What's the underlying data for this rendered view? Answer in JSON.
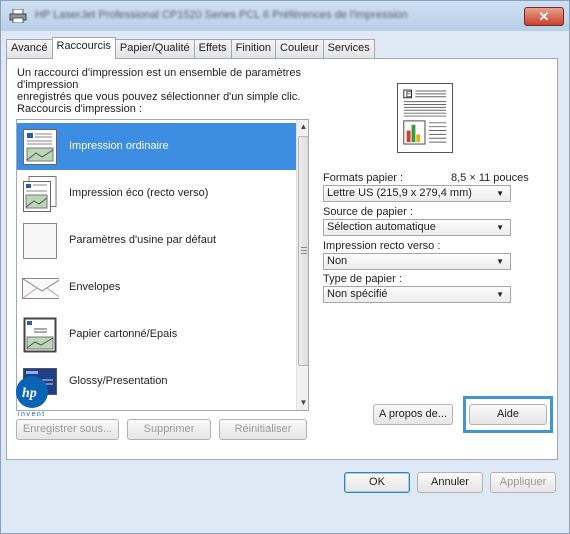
{
  "window": {
    "title": "HP LaserJet Professional CP1520 Series PCL 6 Préférences de l'impression",
    "close_label": "✕"
  },
  "tabs": [
    {
      "label": "Avancé",
      "active": false
    },
    {
      "label": "Raccourcis",
      "active": true
    },
    {
      "label": "Papier/Qualité",
      "active": false
    },
    {
      "label": "Effets",
      "active": false
    },
    {
      "label": "Finition",
      "active": false
    },
    {
      "label": "Couleur",
      "active": false
    },
    {
      "label": "Services",
      "active": false
    }
  ],
  "description_line1": "Un raccourci d'impression est un ensemble de paramètres d'impression",
  "description_line2": "enregistrés que vous pouvez sélectionner d'un simple clic.",
  "shortcuts_label": "Raccourcis d'impression :",
  "shortcuts": [
    {
      "label": "Impression ordinaire",
      "icon": "document-icon",
      "selected": true
    },
    {
      "label": "Impression éco (recto verso)",
      "icon": "duplex-document-icon",
      "selected": false
    },
    {
      "label": "Paramètres d'usine par défaut",
      "icon": "blank-page-icon",
      "selected": false
    },
    {
      "label": "Envelopes",
      "icon": "envelope-icon",
      "selected": false
    },
    {
      "label": "Papier cartonné/Epais",
      "icon": "cardstock-icon",
      "selected": false
    },
    {
      "label": "Glossy/Presentation",
      "icon": "presentation-icon",
      "selected": false
    }
  ],
  "list_buttons": {
    "save_as": "Enregistrer sous...",
    "delete": "Supprimer",
    "reset": "Réinitialiser"
  },
  "settings": {
    "paper_size_label": "Formats papier :",
    "paper_size_dim": "8,5 × 11 pouces",
    "paper_size_value": "Lettre US (215,9 x 279,4 mm)",
    "paper_source_label": "Source de papier :",
    "paper_source_value": "Sélection automatique",
    "duplex_label": "Impression recto verso :",
    "duplex_value": "Non",
    "paper_type_label": "Type de papier :",
    "paper_type_value": "Non spécifié"
  },
  "logo_text": "invent",
  "footer_buttons": {
    "about": "A propos de...",
    "help": "Aide",
    "ok": "OK",
    "cancel": "Annuler",
    "apply": "Appliquer"
  },
  "colors": {
    "selection": "#3d8ee2",
    "highlight_box": "#3f96d4",
    "hp_blue": "#0a63b5"
  }
}
